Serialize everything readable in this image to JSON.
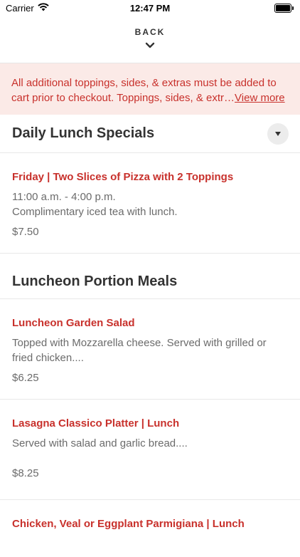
{
  "status_bar": {
    "carrier": "Carrier",
    "time": "12:47 PM"
  },
  "header": {
    "back_label": "BACK"
  },
  "notice": {
    "text": "All additional toppings, sides, & extras must be added to cart prior to checkout. Toppings, sides, & extr…",
    "link": "View more"
  },
  "sections": [
    {
      "title": "Daily Lunch Specials",
      "items": [
        {
          "name": "Friday | Two Slices of Pizza with 2 Toppings",
          "desc": "11:00 a.m. - 4:00 p.m.\nComplimentary iced tea with lunch.",
          "price": "$7.50"
        }
      ]
    },
    {
      "title": "Luncheon Portion Meals",
      "items": [
        {
          "name": "Luncheon Garden Salad",
          "desc": "Topped with Mozzarella cheese. Served with grilled or fried chicken....",
          "price": "$6.25"
        },
        {
          "name": "Lasagna Classico Platter | Lunch",
          "desc": "Served with salad and garlic bread....",
          "price": "$8.25"
        },
        {
          "name": "Chicken, Veal or Eggplant Parmigiana | Lunch",
          "desc": "",
          "price": ""
        }
      ]
    }
  ],
  "colors": {
    "accent": "#c8312c",
    "notice_bg": "#fbeae7"
  }
}
